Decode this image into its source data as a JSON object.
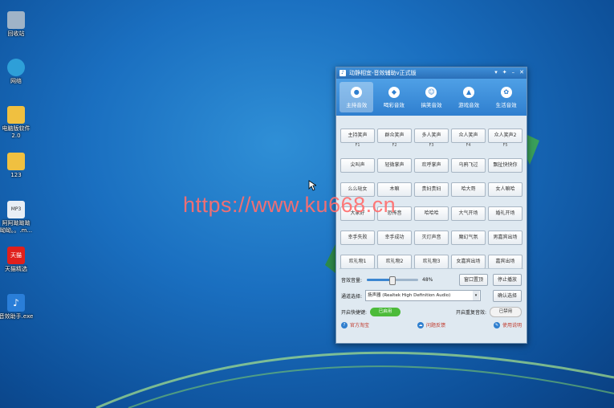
{
  "desktop": {
    "icons": [
      {
        "name": "recycle-bin",
        "label": "回收站",
        "color": "#9fb3c7"
      },
      {
        "name": "network",
        "label": "网络",
        "color": "#2e9fd8"
      },
      {
        "name": "folder-computer-software",
        "label": "电脑版软件\n2.0",
        "color": "#f0c040"
      },
      {
        "name": "folder-123",
        "label": "123",
        "color": "#f0c040"
      },
      {
        "name": "mp3-file",
        "label": "阿阿呦呦呦\n呦呦。。.m...",
        "color": "#e8eef5"
      },
      {
        "name": "tmall",
        "label": "天猫精选",
        "color": "#e0201c"
      },
      {
        "name": "sound-helper-exe",
        "label": "音效助手.exe",
        "color": "#2a7ed8"
      }
    ],
    "mp3_badge": "MP3",
    "tmall_badge": "天猫"
  },
  "watermark": "https://www.ku668.cn",
  "window": {
    "title": "动静相宜-音效辅助v正式版",
    "tabs": [
      {
        "label": "主持音效",
        "active": true
      },
      {
        "label": "喝彩音效",
        "active": false
      },
      {
        "label": "搞笑音效",
        "active": false
      },
      {
        "label": "游戏音效",
        "active": false
      },
      {
        "label": "生活音效",
        "active": false
      }
    ],
    "sound_rows": [
      {
        "buttons": [
          "主持笑声",
          "群众笑声",
          "多人笑声",
          "众人笑声",
          "众人笑声2"
        ],
        "fkeys": [
          "F1",
          "F2",
          "F3",
          "F4",
          "F5"
        ]
      },
      {
        "buttons": [
          "尖叫声",
          "轻微掌声",
          "欢呼掌声",
          "乌鸦飞过",
          "飘扯快快你"
        ],
        "fkeys": []
      },
      {
        "buttons": [
          "么么哒女",
          "木嘛",
          "贵妇贵妇",
          "哈大哥",
          "女人嘛哈"
        ],
        "fkeys": []
      },
      {
        "buttons": [
          "大家好",
          "恐怖音",
          "哈哈哈",
          "大气开场",
          "婚礼开场"
        ],
        "fkeys": []
      },
      {
        "buttons": [
          "幸手失败",
          "幸手成功",
          "灭灯声音",
          "魔幻气氛",
          "男嘉宾出场"
        ],
        "fkeys": []
      },
      {
        "buttons": [
          "欢礼物1",
          "欢礼物2",
          "欢礼物3",
          "女嘉宾出场",
          "嘉宾出场"
        ],
        "fkeys": []
      }
    ],
    "volume_label": "音效音量:",
    "volume_value": "48%",
    "volume_fraction": 0.48,
    "window_top_button": "窗口置顶",
    "stop_button": "停止播放",
    "channel_label": "通道选择:",
    "channel_value": "扬声器 (Realtek High Definition Audio)",
    "confirm_button": "确认选择",
    "hotkey_label": "开启快捷键:",
    "hotkey_state": "已启用",
    "repeat_label": "开启重复音效:",
    "repeat_state": "已禁用",
    "links": [
      "官方淘宝",
      "问题反馈",
      "使用说明"
    ]
  }
}
